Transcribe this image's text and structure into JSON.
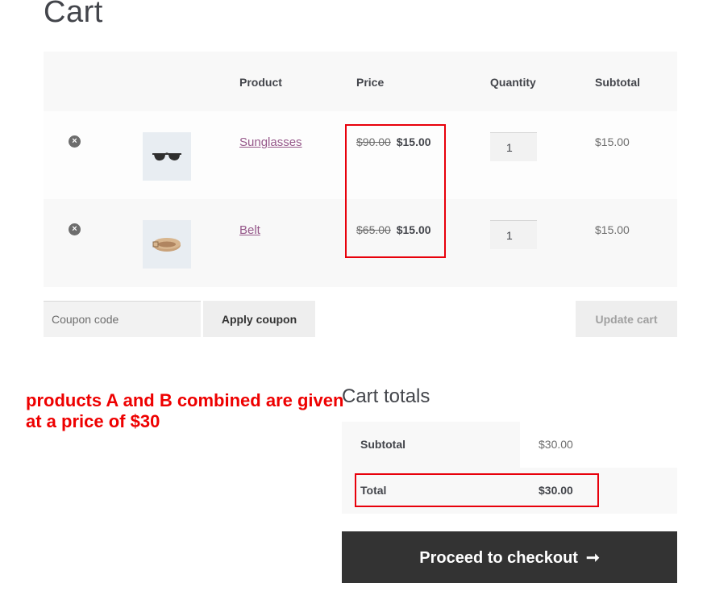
{
  "page": {
    "title": "Cart"
  },
  "table": {
    "headers": {
      "product": "Product",
      "price": "Price",
      "quantity": "Quantity",
      "subtotal": "Subtotal"
    },
    "rows": [
      {
        "name": "Sunglasses",
        "old_price": "$90.00",
        "new_price": "$15.00",
        "quantity": "1",
        "subtotal": "$15.00",
        "image": "sunglasses-icon"
      },
      {
        "name": "Belt",
        "old_price": "$65.00",
        "new_price": "$15.00",
        "quantity": "1",
        "subtotal": "$15.00",
        "image": "belt-icon"
      }
    ],
    "remove_glyph": "×"
  },
  "actions": {
    "coupon_placeholder": "Coupon code",
    "apply_label": "Apply coupon",
    "update_label": "Update cart"
  },
  "annotation": {
    "text": "products A and B combined are given at a price of $30",
    "color": "#ee0000"
  },
  "totals": {
    "title": "Cart totals",
    "subtotal_label": "Subtotal",
    "subtotal_value": "$30.00",
    "total_label": "Total",
    "total_value": "$30.00"
  },
  "checkout": {
    "label": "Proceed to checkout",
    "arrow": "➞"
  },
  "colors": {
    "highlight": "#e8000b",
    "link": "#96588a",
    "button_dark": "#333333"
  }
}
